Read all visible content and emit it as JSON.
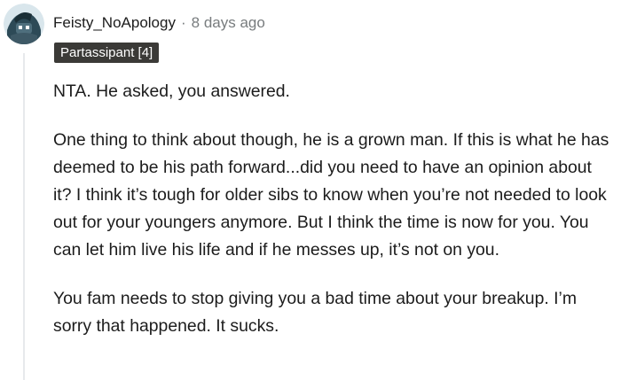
{
  "comment": {
    "author": "Feisty_NoApology",
    "separator": "·",
    "timestamp": "8 days ago",
    "flair": "Partassipant [4]",
    "avatar_icon": "robot-avatar-icon",
    "paragraphs": [
      "NTA. He asked, you answered.",
      "One thing to think about though, he is a grown man. If this is what he has deemed to be his path forward...did you need to have an opinion about it? I think it’s tough for older sibs to know when you’re not needed to look out for your youngers anymore. But I think the time is now for you. You can let him live his life and if he messes up, it’s not on you.",
      "You fam needs to stop giving you a bad time about your breakup. I’m sorry that happened. It sucks."
    ]
  }
}
